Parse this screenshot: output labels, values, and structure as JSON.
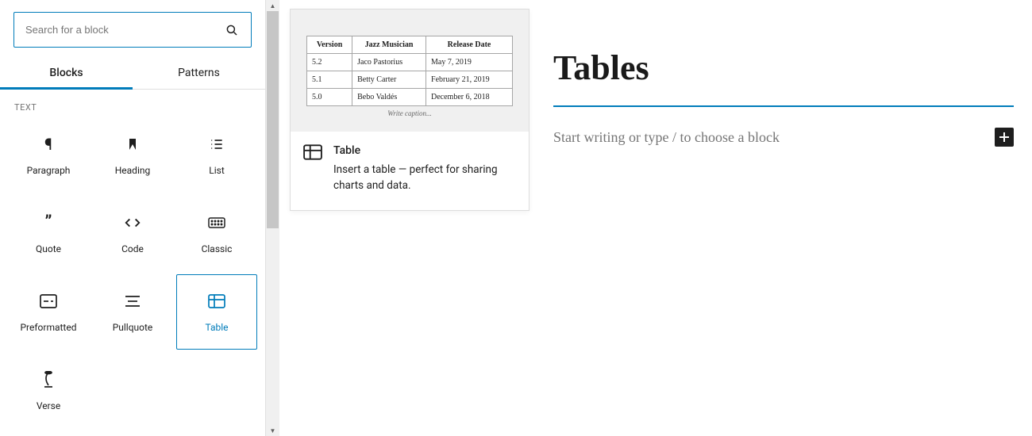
{
  "search": {
    "placeholder": "Search for a block"
  },
  "tabs": {
    "blocks": "Blocks",
    "patterns": "Patterns"
  },
  "section": {
    "text_label": "TEXT"
  },
  "blocks": {
    "paragraph": "Paragraph",
    "heading": "Heading",
    "list": "List",
    "quote": "Quote",
    "code": "Code",
    "classic": "Classic",
    "preformatted": "Preformatted",
    "pullquote": "Pullquote",
    "table": "Table",
    "verse": "Verse"
  },
  "popover": {
    "title": "Table",
    "description": "Insert a table — perfect for sharing charts and data.",
    "caption": "Write caption...",
    "headers": {
      "version": "Version",
      "musician": "Jazz Musician",
      "date": "Release Date"
    },
    "rows": [
      {
        "version": "5.2",
        "musician": "Jaco Pastorius",
        "date": "May 7, 2019"
      },
      {
        "version": "5.1",
        "musician": "Betty Carter",
        "date": "February 21, 2019"
      },
      {
        "version": "5.0",
        "musician": "Bebo Valdés",
        "date": "December 6, 2018"
      }
    ]
  },
  "editor": {
    "title": "Tables",
    "placeholder": "Start writing or type / to choose a block"
  }
}
